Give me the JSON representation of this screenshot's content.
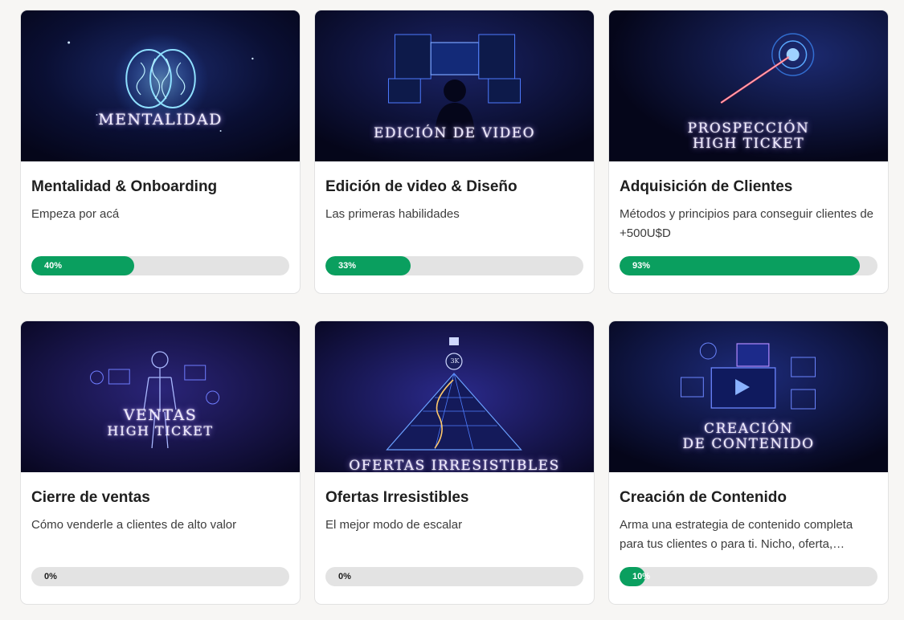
{
  "colors": {
    "accent": "#0a9f5f",
    "track": "#e3e3e3",
    "background": "#f7f6f4"
  },
  "courses": [
    {
      "thumb_lines": [
        "MENTALIDAD",
        ""
      ],
      "thumb_icon": "brain-icon",
      "title": "Mentalidad & Onboarding",
      "description": "Empeza por acá",
      "progress_label": "40%",
      "progress": 40
    },
    {
      "thumb_lines": [
        "EDICIÓN DE VIDEO",
        ""
      ],
      "thumb_icon": "video-editor-icon",
      "title": "Edición de video & Diseño",
      "description": "Las primeras habilidades",
      "progress_label": "33%",
      "progress": 33
    },
    {
      "thumb_lines": [
        "PROSPECCIÓN",
        "HIGH TICKET"
      ],
      "thumb_icon": "target-icon",
      "title": "Adquisición de Clientes",
      "description": "Métodos y principios para conseguir clientes de +500U$D",
      "progress_label": "93%",
      "progress": 93
    },
    {
      "thumb_lines": [
        "VENTAS",
        "HIGH TICKET"
      ],
      "thumb_icon": "person-hologram-icon",
      "title": "Cierre de ventas",
      "description": "Cómo venderle a clientes de alto valor",
      "progress_label": "0%",
      "progress": 0
    },
    {
      "thumb_lines": [
        "OFERTAS IRRESISTIBLES",
        ""
      ],
      "thumb_icon": "pyramid-icon",
      "thumb_badge": "3K",
      "title": "Ofertas Irresistibles",
      "description": "El mejor modo de escalar",
      "progress_label": "0%",
      "progress": 0
    },
    {
      "thumb_lines": [
        "CREACIÓN",
        "DE CONTENIDO"
      ],
      "thumb_icon": "content-screens-icon",
      "title": "Creación de Contenido",
      "description": "Arma una estrategia de contenido completa para tus clientes o para ti. Nicho, oferta,…",
      "progress_label": "10%",
      "progress": 10
    }
  ]
}
